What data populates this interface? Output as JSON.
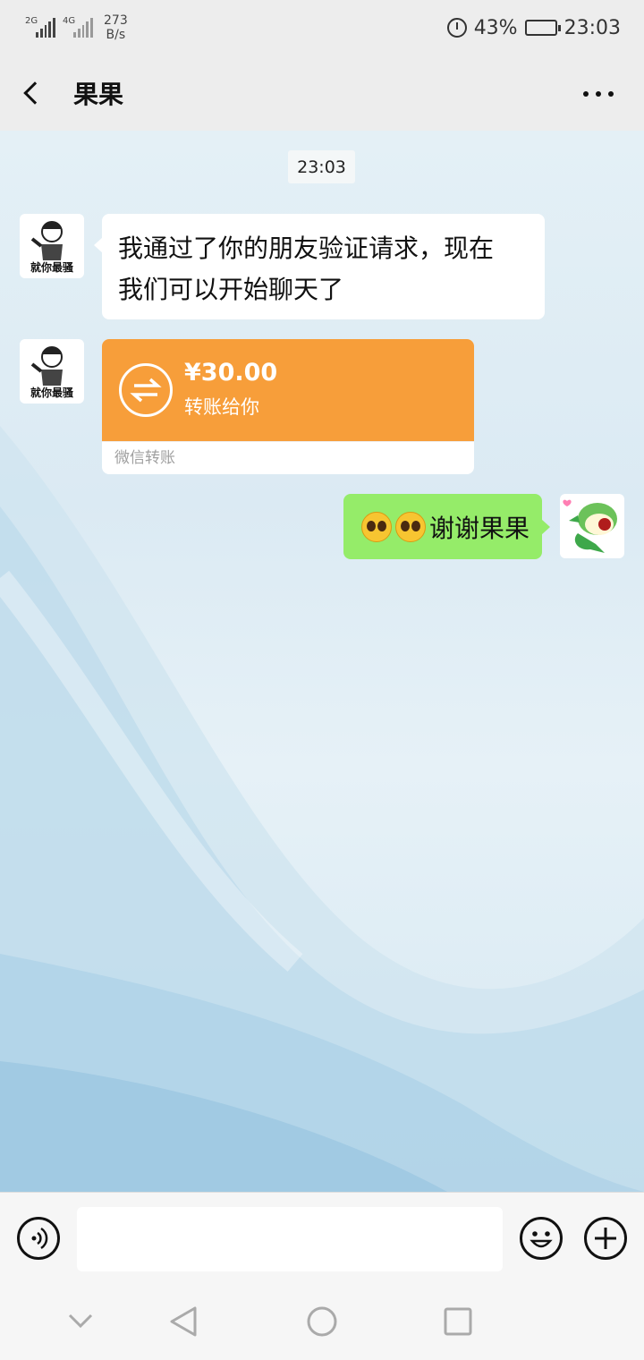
{
  "status_bar": {
    "network_1": "2G",
    "network_2": "4G",
    "speed_value": "273",
    "speed_unit": "B/s",
    "battery_percent": "43%",
    "battery_level": 0.43,
    "time": "23:03"
  },
  "header": {
    "title": "果果"
  },
  "chat": {
    "timestamp": "23:03",
    "messages": [
      {
        "sender": "other",
        "avatar_caption": "就你最骚",
        "text_line1": "我通过了你的朋友验证请求，现在",
        "text_line2": "我们可以开始聊天了"
      },
      {
        "sender": "other",
        "avatar_caption": "就你最骚",
        "transfer": {
          "amount": "¥30.00",
          "description": "转账给你",
          "footer": "微信转账"
        }
      },
      {
        "sender": "me",
        "text": "谢谢果果"
      }
    ]
  },
  "input_bar": {
    "text_value": ""
  },
  "colors": {
    "background": "#ededed",
    "incoming_bubble": "#ffffff",
    "outgoing_bubble": "#95ec69",
    "transfer": "#f79e3a"
  }
}
